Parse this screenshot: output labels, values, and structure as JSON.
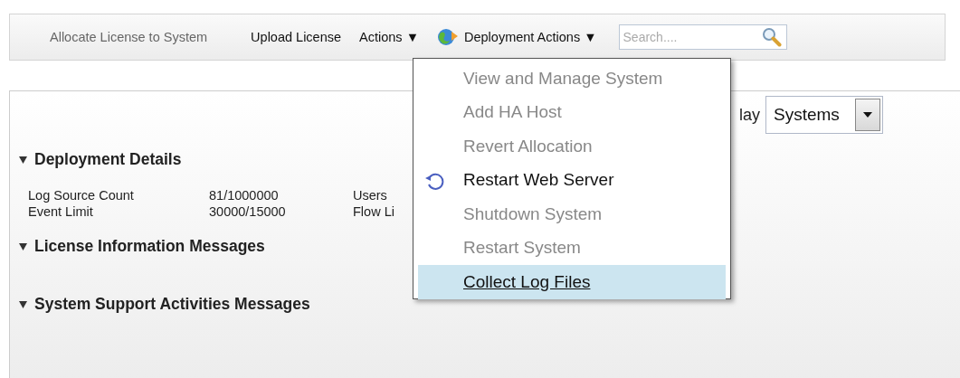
{
  "toolbar": {
    "items": [
      {
        "label": "Allocate License to System",
        "disabled": true,
        "kind": "link"
      },
      {
        "label": "Upload License",
        "disabled": false,
        "kind": "link"
      },
      {
        "label": "Actions ▼",
        "disabled": false,
        "kind": "menu"
      },
      {
        "label": "Deployment Actions ▼",
        "disabled": false,
        "kind": "menu-icon"
      }
    ],
    "search": {
      "placeholder": "Search...."
    }
  },
  "display": {
    "label": "lay",
    "value": "Systems"
  },
  "sections": [
    {
      "title": "Deployment Details",
      "expanded": true,
      "rows": [
        [
          "Log Source Count",
          "81/1000000",
          "Users"
        ],
        [
          "Event Limit",
          "30000/15000",
          "Flow Li"
        ]
      ]
    },
    {
      "title": "License Information Messages",
      "expanded": true
    },
    {
      "title": "System Support Activities Messages",
      "expanded": true
    }
  ],
  "menu": {
    "items": [
      {
        "label": "View and Manage System",
        "disabled": true,
        "selected": false,
        "kind": "plain"
      },
      {
        "label": "Add HA Host",
        "disabled": true,
        "selected": false,
        "kind": "plain"
      },
      {
        "label": "Revert Allocation",
        "disabled": true,
        "selected": false,
        "kind": "plain"
      },
      {
        "label": "Restart Web Server",
        "disabled": false,
        "selected": false,
        "kind": "restart"
      },
      {
        "label": "Shutdown System",
        "disabled": true,
        "selected": false,
        "kind": "plain"
      },
      {
        "label": "Restart System",
        "disabled": true,
        "selected": false,
        "kind": "plain"
      },
      {
        "label": "Collect Log Files",
        "disabled": false,
        "selected": true,
        "kind": "plain"
      }
    ]
  }
}
